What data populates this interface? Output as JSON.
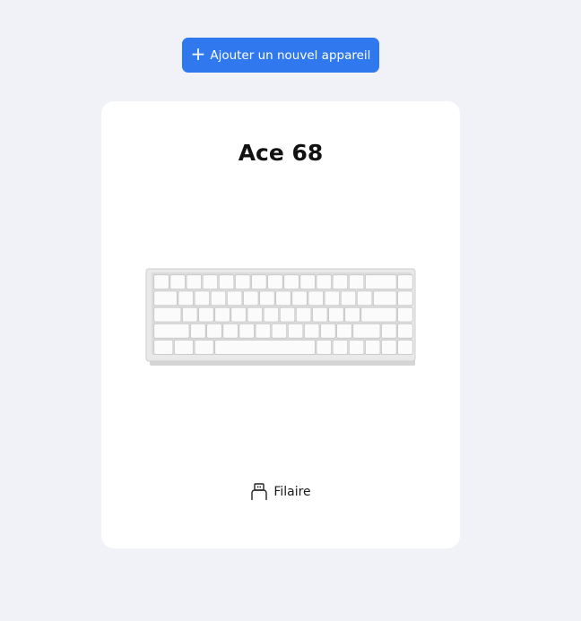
{
  "toolbar": {
    "add_device_label": "Ajouter un nouvel appareil",
    "add_icon": "plus-icon",
    "accent_color": "#2f78ee"
  },
  "device": {
    "name": "Ace 68",
    "image": "keyboard-image",
    "connection_icon": "usb-icon",
    "connection_label": "Filaire"
  }
}
